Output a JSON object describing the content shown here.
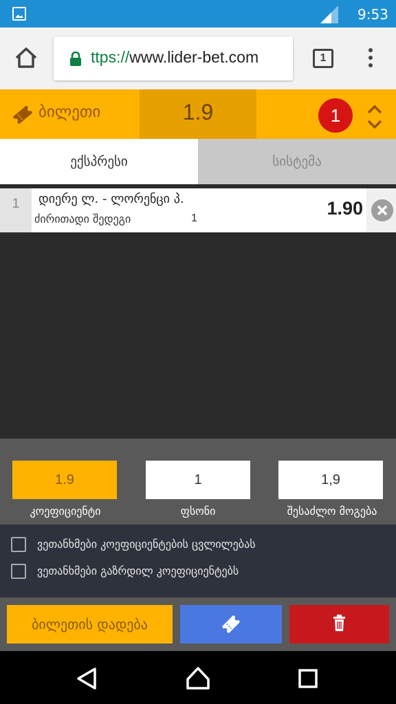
{
  "status_bar": {
    "time": "9:53",
    "icons": [
      "image-icon",
      "signal-icon"
    ]
  },
  "browser": {
    "url_scheme": "ttps://",
    "url_host": "www.lider-bet.com",
    "tab_count": "1",
    "icons": [
      "home-icon",
      "lock-icon",
      "tabs-icon",
      "overflow-menu-icon"
    ]
  },
  "ticket": {
    "title": "ბილეთი",
    "total_odds": "1.9",
    "bet_count": "1",
    "icons": [
      "ticket-icon",
      "expand-collapse-icon"
    ]
  },
  "tabs": [
    {
      "label": "ექსპრესი",
      "active": true
    },
    {
      "label": "სისტემა",
      "active": false
    }
  ],
  "bets": [
    {
      "index": "1",
      "event": "დიერე ლ. - ლორენცი პ.",
      "market": "ძირითადი შედეგი",
      "selection": "1",
      "odds": "1.90"
    }
  ],
  "summary": {
    "odds_value": "1.9",
    "odds_label": "კოეფიციენტი",
    "stake_value": "1",
    "stake_label": "ფსონი",
    "win_value": "1,9",
    "win_label": "შესაძლო მოგება"
  },
  "options": [
    {
      "label": "ვეთანხმები კოეფიციენტების ცვლილებას",
      "checked": false
    },
    {
      "label": "ვეთანხმები გაზრდილ კოეფიციენტებს",
      "checked": false
    }
  ],
  "actions": {
    "place_label": "ბილეთის დადება",
    "icons": [
      "ticket-icon",
      "trash-icon"
    ]
  },
  "colors": {
    "accent": "#ffb300",
    "status_bar": "#1e8fd3",
    "badge": "#d71414",
    "ticket_button": "#4a78e0",
    "clear_button": "#c7191d"
  },
  "nav": {
    "icons": [
      "back-icon",
      "home-icon",
      "recents-icon"
    ]
  }
}
